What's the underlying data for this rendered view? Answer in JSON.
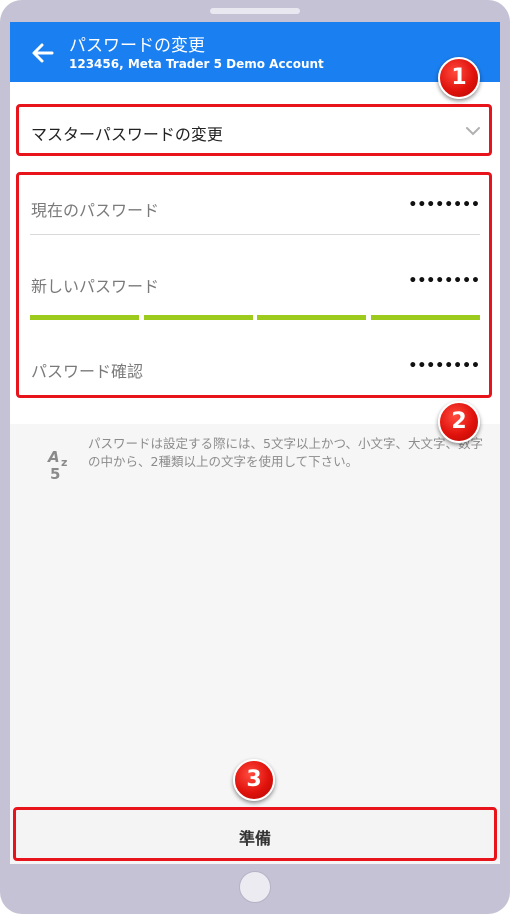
{
  "header": {
    "title": "パスワードの変更",
    "subtitle": "123456, Meta Trader 5 Demo Account"
  },
  "password_type": {
    "selected": "マスターパスワードの変更"
  },
  "fields": [
    {
      "label": "現在のパスワード",
      "value": "••••••••"
    },
    {
      "label": "新しいパスワード",
      "value": "••••••••"
    },
    {
      "label": "パスワード確認",
      "value": "••••••••"
    }
  ],
  "strength": {
    "filled_segments": 4,
    "total_segments": 4,
    "color": "#9ccb1e"
  },
  "hint": {
    "text": "パスワードは設定する際には、5文字以上かつ、小文字、大文字、数字の中から、2種類以上の文字を使用して下さい。",
    "icon": "a-z-5-icon"
  },
  "footer": {
    "button_label": "準備"
  },
  "annotations": [
    "1",
    "2",
    "3"
  ],
  "colors": {
    "appbar": "#1a7ff0",
    "highlight": "#e8141b"
  }
}
